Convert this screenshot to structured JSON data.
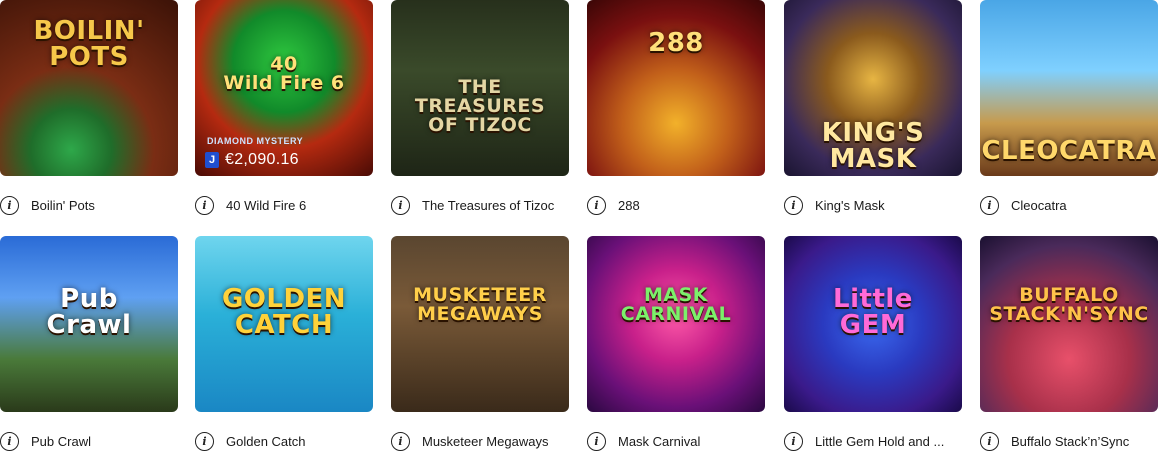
{
  "games": [
    {
      "name": "Boilin' Pots",
      "art": "BOILIN' POTS",
      "title_color": "#f6c84a",
      "bg": "radial-gradient(circle at 40% 85%, #2ea84a 0%, #1f6d2a 22%, #7a2d14 45%, #3b1207 100%)"
    },
    {
      "name": "40 Wild Fire 6",
      "art": "40\nWild Fire 6",
      "title_color": "#ffe27a",
      "bg": "radial-gradient(circle at 50% 35%, #2fc83f 0%, #118a2a 35%, #b52a10 60%, #4a0b05 100%)",
      "jackpot": {
        "badge": "J",
        "amount": "€2,090.16",
        "brand": "DIAMOND MYSTERY"
      }
    },
    {
      "name": "The Treasures of Tizoc",
      "art": "THE TREASURES\nOF TIZOC",
      "title_color": "#e4d6a4",
      "bg": "linear-gradient(180deg,#27301c 0%,#3a4a2a 40%,#1e2516 100%)"
    },
    {
      "name": "288",
      "art": "288",
      "title_color": "#ffe07a",
      "bg": "radial-gradient(circle at 50% 70%, #f2b12a 0%, #c2601a 35%, #7a1010 70%, #3a0606 100%)"
    },
    {
      "name": "King's Mask",
      "art": "KING'S MASK",
      "title_color": "#ffe8a0",
      "bg": "radial-gradient(circle at 50% 45%, #e7b543 0%, #8a5a1d 35%, #3a2a5a 70%, #1a1430 100%)"
    },
    {
      "name": "Cleocatra",
      "art": "CLEOCATRA",
      "title_color": "#ffd86b",
      "bg": "linear-gradient(180deg,#4aa6e6 0%,#7fd0ff 40%,#c79a4c 70%,#6a3a1a 100%)"
    },
    {
      "name": "Pub Crawl",
      "art": "Pub\nCrawl",
      "title_color": "#ffffff",
      "bg": "linear-gradient(180deg,#2a6bd6 0%,#5fa0f2 35%,#4a7a3a 70%,#2a3a1a 100%)"
    },
    {
      "name": "Golden Catch",
      "art": "GOLDEN\nCATCH",
      "title_color": "#ffd23a",
      "bg": "linear-gradient(180deg,#6fd5ee 0%,#2ab0d8 45%,#1a87c4 100%)"
    },
    {
      "name": "Musketeer Megaways",
      "art": "MUSKETEER\nMEGAWAYS",
      "title_color": "#ffcf4a",
      "bg": "linear-gradient(180deg,#5a4630 0%,#7a5a38 40%,#3a2a1a 100%)"
    },
    {
      "name": "Mask Carnival",
      "art": "MASK\nCARNIVAL",
      "title_color": "#7cf06a",
      "bg": "radial-gradient(circle at 50% 45%, #ff5aa8 0%, #c8208a 35%, #6a1078 70%, #2a0840 100%)"
    },
    {
      "name": "Little Gem Hold and ...",
      "art": "Little\nGEM",
      "title_color": "#ff6ad8",
      "bg": "radial-gradient(circle at 50% 50%, #3a6af0 0%, #2a3ac0 40%, #3a1a8a 75%, #1a0a4a 100%)"
    },
    {
      "name": "Buffalo Stack’n’Sync",
      "art": "BUFFALO\nSTACK'N'SYNC",
      "title_color": "#ffc24a",
      "bg": "radial-gradient(circle at 50% 70%, #e8506a 0%, #a8304a 40%, #4a2a5a 75%, #1a1030 100%)"
    }
  ],
  "icons": {
    "info": "info-icon"
  }
}
